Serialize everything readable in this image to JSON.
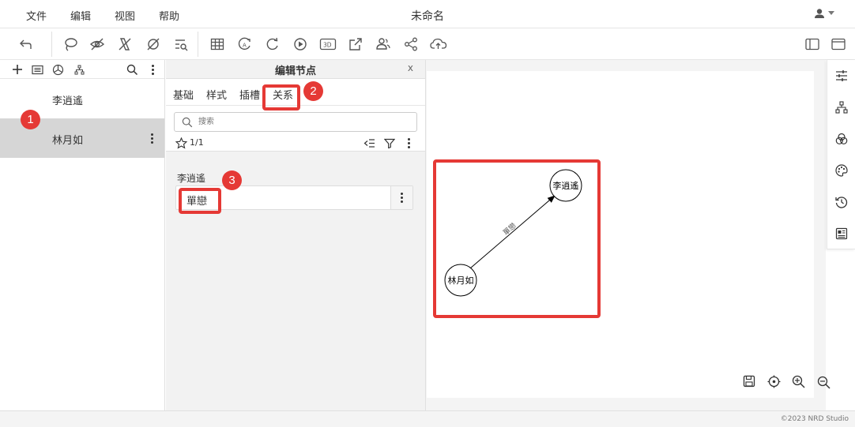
{
  "menu": {
    "file": "文件",
    "edit": "编辑",
    "view": "视图",
    "help": "帮助"
  },
  "app_title": "未命名",
  "node_list": {
    "items": [
      {
        "label": "李逍遙"
      },
      {
        "label": "林月如"
      }
    ]
  },
  "edit_panel": {
    "title": "编辑节点",
    "close": "x",
    "tabs": [
      {
        "label": "基础"
      },
      {
        "label": "样式"
      },
      {
        "label": "插槽"
      },
      {
        "label": "关系"
      }
    ],
    "search_placeholder": "搜索",
    "star_count": "1/1",
    "relation": {
      "target": "李逍遙",
      "value": "單戀"
    }
  },
  "graph": {
    "nodes": [
      {
        "label": "李逍遙"
      },
      {
        "label": "林月如"
      }
    ],
    "edge_label": "單戀"
  },
  "annotations": {
    "b1": "1",
    "b2": "2",
    "b3": "3",
    "color": "#e53935"
  },
  "footer": {
    "copyright": "©2023 NRD Studio"
  }
}
